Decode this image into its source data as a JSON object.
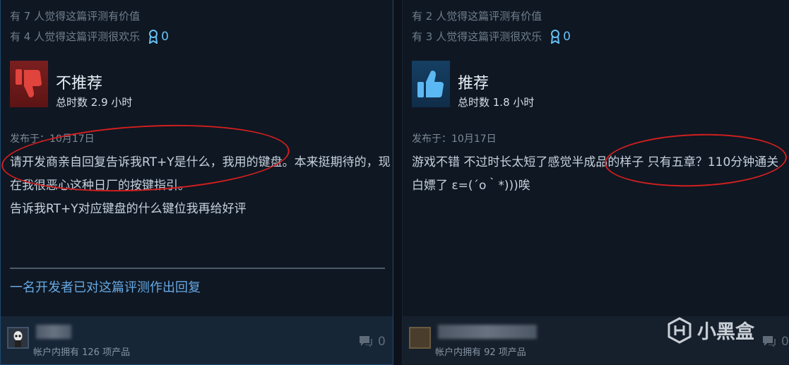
{
  "reviews": [
    {
      "helpful_text": "有 7 人觉得这篇评测有价值",
      "funny_text": "有 4 人觉得这篇评测很欢乐",
      "awards": "0",
      "verdict": "不推荐",
      "verdict_icon": "thumbs-down-icon",
      "hours": "总时数 2.9 小时",
      "posted": "发布于：10月17日",
      "body_lines": [
        "请开发商亲自回复告诉我RT+Y是什么，我用的键盘。本来挺期待的，现",
        "在我很恶心这种日厂的按键指引。",
        "告诉我RT+Y对应键盘的什么键位我再给好评"
      ],
      "dev_reply": "一名开发者已对这篇评测作出回复",
      "owned": "帐户内拥有 126 项产品",
      "comments": "0"
    },
    {
      "helpful_text": "有 2 人觉得这篇评测有价值",
      "funny_text": "有 3 人觉得这篇评测很欢乐",
      "awards": "0",
      "verdict": "推荐",
      "verdict_icon": "thumbs-up-icon",
      "hours": "总时数 1.8 小时",
      "posted": "发布于：10月17日",
      "body_lines": [
        "游戏不错 不过时长太短了感觉半成品的样子 只有五章？110分钟通关",
        "白嫖了 ε=(´ο｀*)))唉"
      ],
      "owned": "帐户内拥有 92 项产品",
      "comments": "0"
    }
  ],
  "watermark": "小黑盒",
  "colors": {
    "accent": "#66c0f4",
    "annotation": "#d21f1f"
  }
}
